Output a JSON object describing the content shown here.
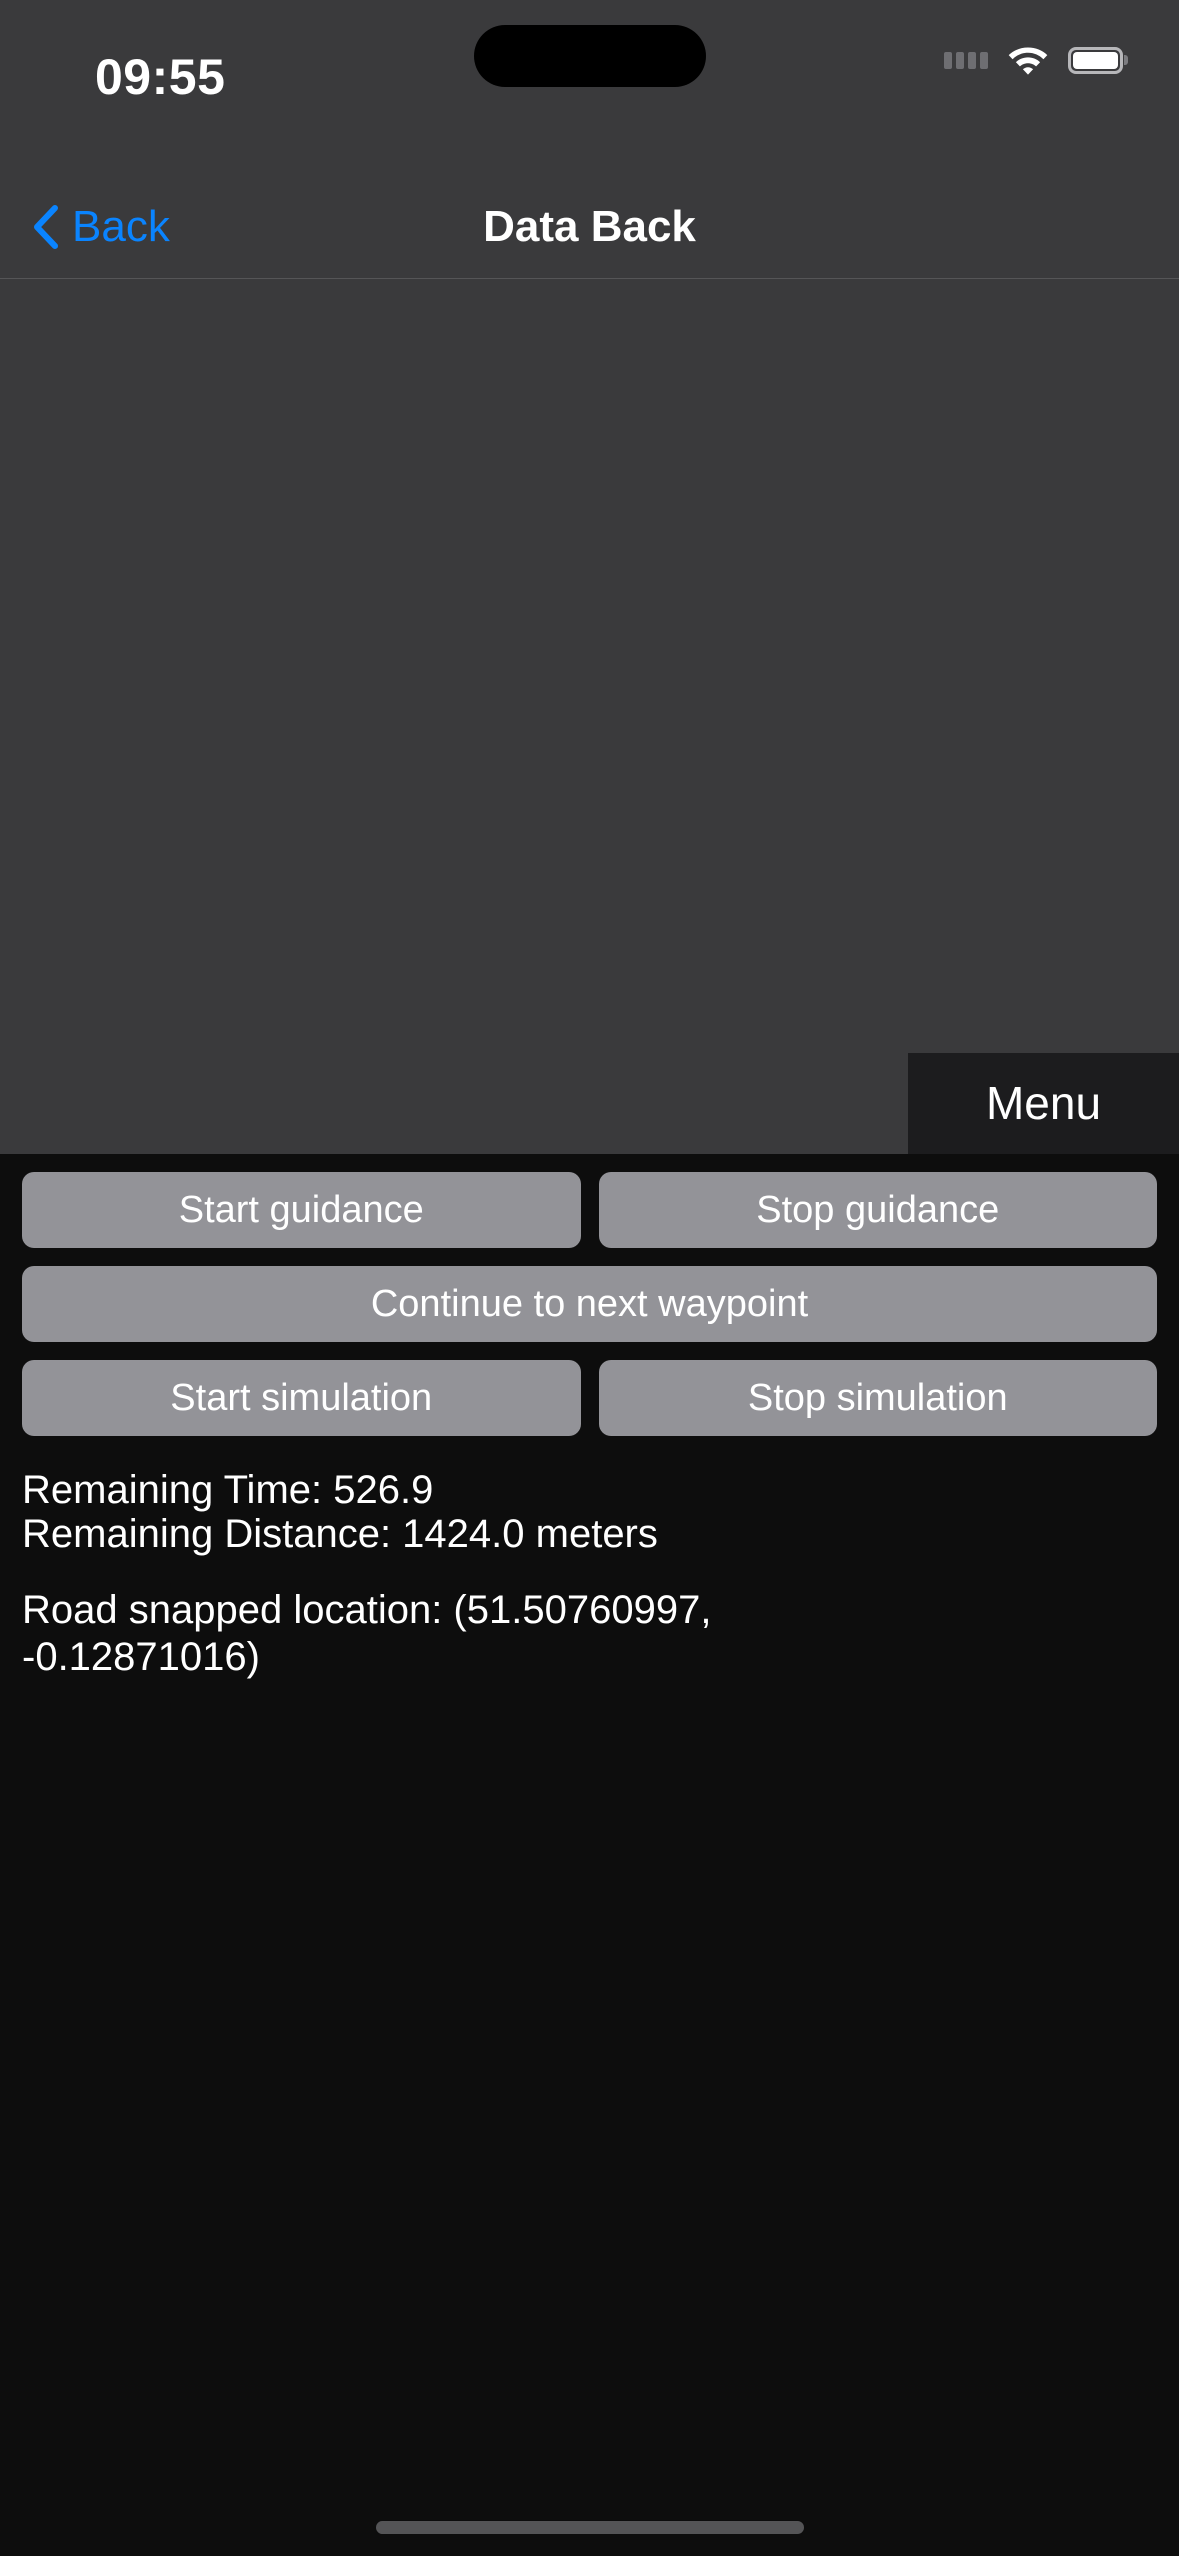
{
  "status_bar": {
    "time": "09:55",
    "icons": {
      "signal": "signal-dots-icon",
      "wifi": "wifi-icon",
      "battery": "battery-icon"
    }
  },
  "nav_bar": {
    "back_label": "Back",
    "back_icon": "chevron-left-icon",
    "title": "Data Back"
  },
  "map": {
    "menu_label": "Menu"
  },
  "controls": {
    "row1": [
      {
        "label": "Start guidance"
      },
      {
        "label": "Stop guidance"
      }
    ],
    "row2": [
      {
        "label": "Continue to next waypoint"
      }
    ],
    "row3": [
      {
        "label": "Start simulation"
      },
      {
        "label": "Stop simulation"
      }
    ]
  },
  "status": {
    "remaining_time": "Remaining Time: 526.9",
    "remaining_distance": "Remaining Distance: 1424.0 meters",
    "road_snapped_line1": "Road snapped location: (51.50760997,",
    "road_snapped_line2": "-0.12871016)"
  },
  "colors": {
    "accent_blue": "#0a84ff",
    "panel_bg": "#0d0d0d",
    "map_bg": "#3a3a3c",
    "button_gray": "#939398",
    "menu_bg": "#1c1c1e"
  }
}
